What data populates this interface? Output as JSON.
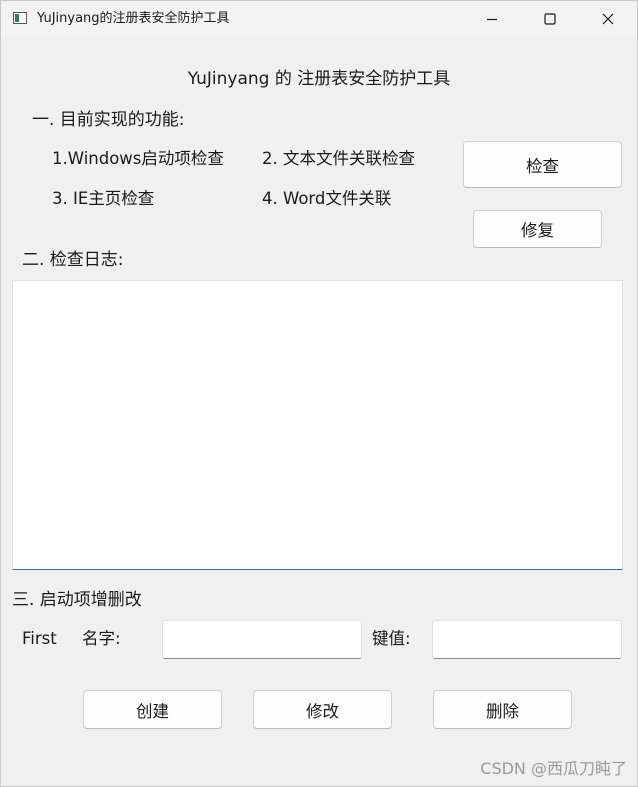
{
  "window": {
    "title": "YuJinyang的注册表安全防护工具",
    "controls": {
      "minimize_icon": "minimize-icon",
      "maximize_icon": "maximize-icon",
      "close_icon": "close-icon"
    }
  },
  "main": {
    "heading": "YuJinyang 的 注册表安全防护工具",
    "section1": {
      "title": "一. 目前实现的功能:",
      "features": [
        "1.Windows启动项检查",
        "2. 文本文件关联检查",
        "3. IE主页检查",
        "4. Word文件关联"
      ],
      "check_button": "检查",
      "repair_button": "修复"
    },
    "section2": {
      "title": "二. 检查日志:",
      "log_value": ""
    },
    "section3": {
      "title": "三. 启动项增删改",
      "first_label": "First",
      "name_label": "名字:",
      "name_value": "",
      "key_label": "键值:",
      "key_value": "",
      "create_button": "创建",
      "modify_button": "修改",
      "delete_button": "删除"
    }
  },
  "watermark": "CSDN @西瓜刀盹了",
  "colors": {
    "background": "#f0f0f0",
    "focus_accent": "#2f6ea8",
    "text": "#1a1a1a"
  }
}
